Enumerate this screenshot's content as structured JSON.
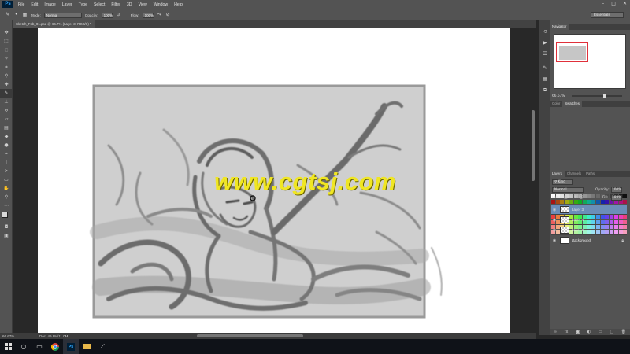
{
  "app": {
    "logo": "Ps"
  },
  "menu": [
    "File",
    "Edit",
    "Image",
    "Layer",
    "Type",
    "Select",
    "Filter",
    "3D",
    "View",
    "Window",
    "Help"
  ],
  "window_controls": [
    "–",
    "□",
    "✕"
  ],
  "options_bar": {
    "mode_label": "Mode:",
    "mode_value": "Normal",
    "opacity_label": "Opacity:",
    "opacity_value": "100%",
    "flow_label": "Flow:",
    "flow_value": "100%",
    "workspace": "Essentials"
  },
  "document": {
    "tab_title": "Sketch_Feb_01.psd @ 66.7% (Layer 3, RGB/8) *"
  },
  "status": {
    "zoom": "66.67%",
    "doc_size": "Doc: 49.8M/11.0M"
  },
  "watermark": "www.cgtsj.com",
  "navigator": {
    "tab": "Navigator",
    "zoom": "66.67%"
  },
  "color_panel": {
    "tabs": [
      "Color",
      "Swatches"
    ]
  },
  "layers_panel": {
    "tabs": [
      "Layers",
      "Channels",
      "Paths"
    ],
    "kind_label": "Kind",
    "blend_mode": "Normal",
    "opacity_label": "Opacity:",
    "opacity_value": "100%",
    "lock_label": "Lock:",
    "fill_label": "Fill:",
    "fill_value": "100%",
    "layers": [
      {
        "name": "Layer 3",
        "selected": true
      },
      {
        "name": "Layer 4",
        "selected": false
      },
      {
        "name": "Layer 2",
        "selected": false
      },
      {
        "name": "Background",
        "selected": false
      }
    ]
  },
  "taskbar": {
    "icons": [
      "windows-icon",
      "search-icon",
      "taskview-icon",
      "chrome-icon",
      "photoshop-icon",
      "explorer-icon",
      "app-icon"
    ]
  }
}
